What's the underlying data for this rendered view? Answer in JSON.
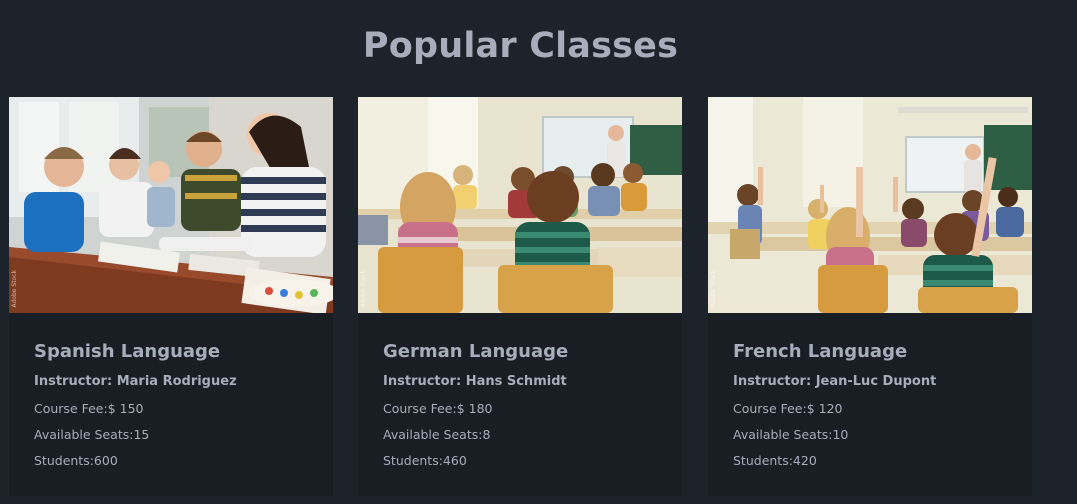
{
  "section": {
    "title": "Popular Classes"
  },
  "classes": [
    {
      "name": "Spanish Language",
      "instructor": "Instructor: Maria Rodriguez",
      "fee": "Course Fee:$ 150",
      "seats": "Available Seats:15",
      "students": "Students:600",
      "image": "photo-teacher-helping-kids"
    },
    {
      "name": "German Language",
      "instructor": "Instructor: Hans Schmidt",
      "fee": "Course Fee:$ 180",
      "seats": "Available Seats:8",
      "students": "Students:460",
      "image": "photo-classroom-students-desks"
    },
    {
      "name": "French Language",
      "instructor": "Instructor: Jean-Luc Dupont",
      "fee": "Course Fee:$ 120",
      "seats": "Available Seats:10",
      "students": "Students:420",
      "image": "photo-classroom-hands-raised"
    }
  ]
}
